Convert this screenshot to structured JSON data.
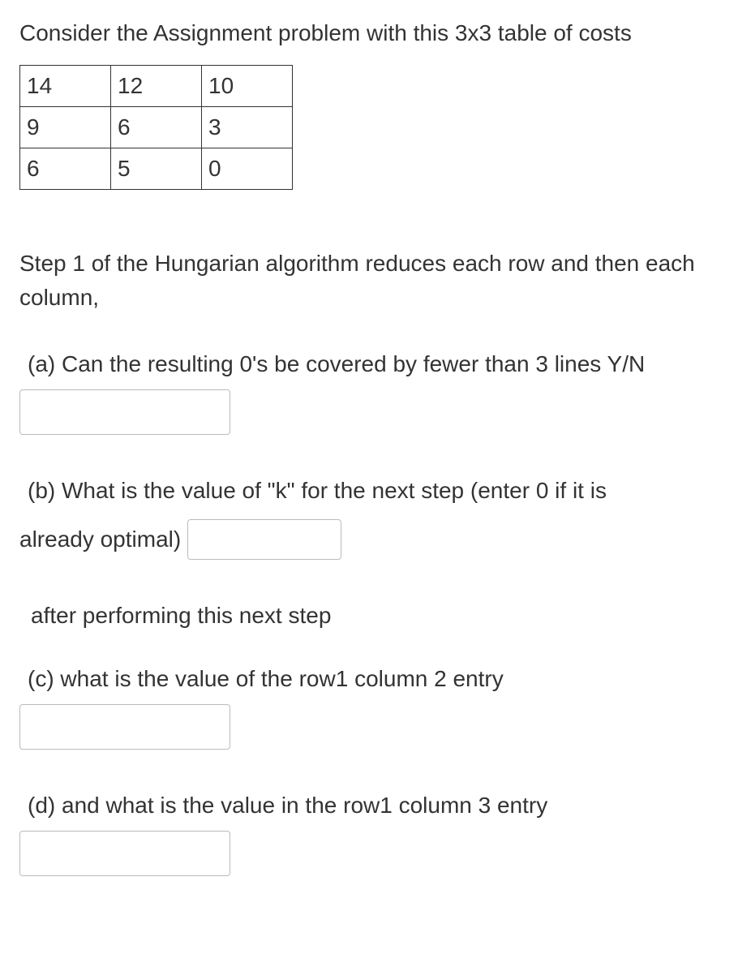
{
  "intro": "Consider the Assignment problem with this 3x3 table of costs",
  "cost_table": {
    "rows": [
      {
        "c1": "14",
        "c2": "12",
        "c3": "10"
      },
      {
        "c1": "9",
        "c2": "6",
        "c3": "3"
      },
      {
        "c1": "6",
        "c2": "5",
        "c3": "0"
      }
    ]
  },
  "step_text": "Step 1 of the Hungarian algorithm reduces each row and then each column,",
  "part_a": {
    "text": "(a)  Can the resulting 0's be covered by fewer than 3 lines  Y/N"
  },
  "part_b": {
    "text_first": "(b)  What is the value of  \"k\"  for the next step  (enter 0 if it is",
    "text_second": "already optimal)"
  },
  "after_step": "after performing this next step",
  "part_c": {
    "text": "(c)  what is the value of the  row1 column 2   entry"
  },
  "part_d": {
    "text": "(d)  and what is the value in the  row1 column 3 entry"
  }
}
